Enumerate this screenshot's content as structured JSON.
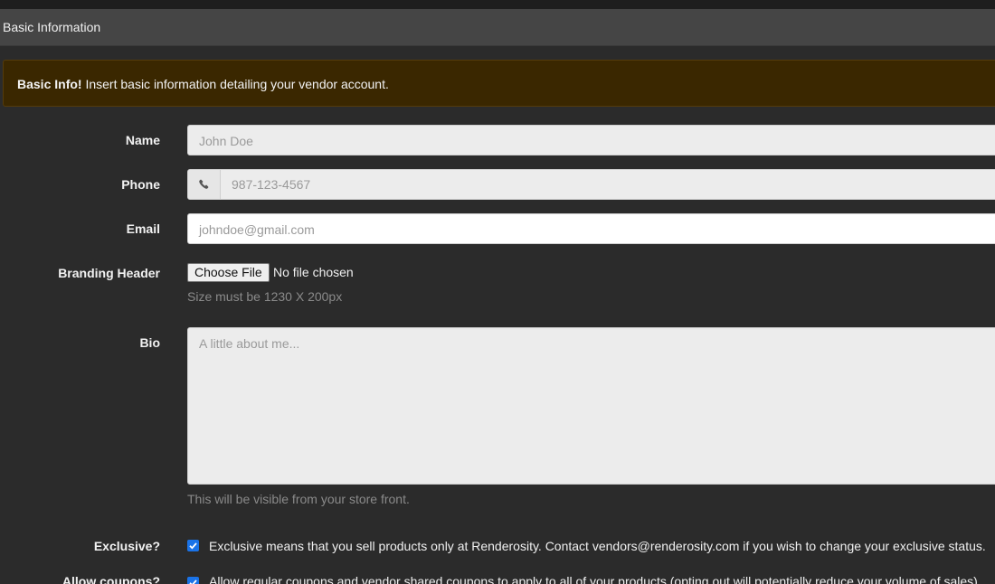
{
  "panel": {
    "title": "Basic Information"
  },
  "alert": {
    "strong": "Basic Info!",
    "message": " Insert basic information detailing your vendor account."
  },
  "form": {
    "name": {
      "label": "Name",
      "placeholder": "John Doe"
    },
    "phone": {
      "label": "Phone",
      "placeholder": "987-123-4567",
      "icon": "phone-icon"
    },
    "email": {
      "label": "Email",
      "placeholder": "johndoe@gmail.com"
    },
    "branding": {
      "label": "Branding Header",
      "button": "Choose File",
      "status": "No file chosen",
      "help": "Size must be 1230 X 200px"
    },
    "bio": {
      "label": "Bio",
      "placeholder": "A little about me...",
      "help": "This will be visible from your store front."
    },
    "exclusive": {
      "label": "Exclusive?",
      "checked": true,
      "text": "Exclusive means that you sell products only at Renderosity. Contact vendors@renderosity.com if you wish to change your exclusive status."
    },
    "coupons": {
      "label": "Allow coupons?",
      "checked": true,
      "text": "Allow regular coupons and vendor shared coupons to apply to all of your products (opting out will potentially reduce your volume of sales)."
    }
  },
  "colors": {
    "accent": "#1a73e8",
    "alert_bg": "#3a2700",
    "page_bg": "#2b2b2b"
  }
}
